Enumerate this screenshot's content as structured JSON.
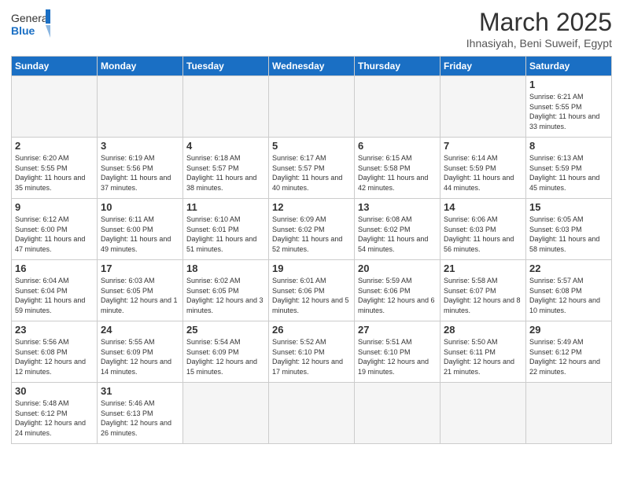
{
  "header": {
    "logo_general": "General",
    "logo_blue": "Blue",
    "month_title": "March 2025",
    "location": "Ihnasiyah, Beni Suweif, Egypt"
  },
  "weekdays": [
    "Sunday",
    "Monday",
    "Tuesday",
    "Wednesday",
    "Thursday",
    "Friday",
    "Saturday"
  ],
  "weeks": [
    [
      {
        "day": "",
        "info": ""
      },
      {
        "day": "",
        "info": ""
      },
      {
        "day": "",
        "info": ""
      },
      {
        "day": "",
        "info": ""
      },
      {
        "day": "",
        "info": ""
      },
      {
        "day": "",
        "info": ""
      },
      {
        "day": "1",
        "info": "Sunrise: 6:21 AM\nSunset: 5:55 PM\nDaylight: 11 hours\nand 33 minutes."
      }
    ],
    [
      {
        "day": "2",
        "info": "Sunrise: 6:20 AM\nSunset: 5:55 PM\nDaylight: 11 hours\nand 35 minutes."
      },
      {
        "day": "3",
        "info": "Sunrise: 6:19 AM\nSunset: 5:56 PM\nDaylight: 11 hours\nand 37 minutes."
      },
      {
        "day": "4",
        "info": "Sunrise: 6:18 AM\nSunset: 5:57 PM\nDaylight: 11 hours\nand 38 minutes."
      },
      {
        "day": "5",
        "info": "Sunrise: 6:17 AM\nSunset: 5:57 PM\nDaylight: 11 hours\nand 40 minutes."
      },
      {
        "day": "6",
        "info": "Sunrise: 6:15 AM\nSunset: 5:58 PM\nDaylight: 11 hours\nand 42 minutes."
      },
      {
        "day": "7",
        "info": "Sunrise: 6:14 AM\nSunset: 5:59 PM\nDaylight: 11 hours\nand 44 minutes."
      },
      {
        "day": "8",
        "info": "Sunrise: 6:13 AM\nSunset: 5:59 PM\nDaylight: 11 hours\nand 45 minutes."
      }
    ],
    [
      {
        "day": "9",
        "info": "Sunrise: 6:12 AM\nSunset: 6:00 PM\nDaylight: 11 hours\nand 47 minutes."
      },
      {
        "day": "10",
        "info": "Sunrise: 6:11 AM\nSunset: 6:00 PM\nDaylight: 11 hours\nand 49 minutes."
      },
      {
        "day": "11",
        "info": "Sunrise: 6:10 AM\nSunset: 6:01 PM\nDaylight: 11 hours\nand 51 minutes."
      },
      {
        "day": "12",
        "info": "Sunrise: 6:09 AM\nSunset: 6:02 PM\nDaylight: 11 hours\nand 52 minutes."
      },
      {
        "day": "13",
        "info": "Sunrise: 6:08 AM\nSunset: 6:02 PM\nDaylight: 11 hours\nand 54 minutes."
      },
      {
        "day": "14",
        "info": "Sunrise: 6:06 AM\nSunset: 6:03 PM\nDaylight: 11 hours\nand 56 minutes."
      },
      {
        "day": "15",
        "info": "Sunrise: 6:05 AM\nSunset: 6:03 PM\nDaylight: 11 hours\nand 58 minutes."
      }
    ],
    [
      {
        "day": "16",
        "info": "Sunrise: 6:04 AM\nSunset: 6:04 PM\nDaylight: 11 hours\nand 59 minutes."
      },
      {
        "day": "17",
        "info": "Sunrise: 6:03 AM\nSunset: 6:05 PM\nDaylight: 12 hours\nand 1 minute."
      },
      {
        "day": "18",
        "info": "Sunrise: 6:02 AM\nSunset: 6:05 PM\nDaylight: 12 hours\nand 3 minutes."
      },
      {
        "day": "19",
        "info": "Sunrise: 6:01 AM\nSunset: 6:06 PM\nDaylight: 12 hours\nand 5 minutes."
      },
      {
        "day": "20",
        "info": "Sunrise: 5:59 AM\nSunset: 6:06 PM\nDaylight: 12 hours\nand 6 minutes."
      },
      {
        "day": "21",
        "info": "Sunrise: 5:58 AM\nSunset: 6:07 PM\nDaylight: 12 hours\nand 8 minutes."
      },
      {
        "day": "22",
        "info": "Sunrise: 5:57 AM\nSunset: 6:08 PM\nDaylight: 12 hours\nand 10 minutes."
      }
    ],
    [
      {
        "day": "23",
        "info": "Sunrise: 5:56 AM\nSunset: 6:08 PM\nDaylight: 12 hours\nand 12 minutes."
      },
      {
        "day": "24",
        "info": "Sunrise: 5:55 AM\nSunset: 6:09 PM\nDaylight: 12 hours\nand 14 minutes."
      },
      {
        "day": "25",
        "info": "Sunrise: 5:54 AM\nSunset: 6:09 PM\nDaylight: 12 hours\nand 15 minutes."
      },
      {
        "day": "26",
        "info": "Sunrise: 5:52 AM\nSunset: 6:10 PM\nDaylight: 12 hours\nand 17 minutes."
      },
      {
        "day": "27",
        "info": "Sunrise: 5:51 AM\nSunset: 6:10 PM\nDaylight: 12 hours\nand 19 minutes."
      },
      {
        "day": "28",
        "info": "Sunrise: 5:50 AM\nSunset: 6:11 PM\nDaylight: 12 hours\nand 21 minutes."
      },
      {
        "day": "29",
        "info": "Sunrise: 5:49 AM\nSunset: 6:12 PM\nDaylight: 12 hours\nand 22 minutes."
      }
    ],
    [
      {
        "day": "30",
        "info": "Sunrise: 5:48 AM\nSunset: 6:12 PM\nDaylight: 12 hours\nand 24 minutes."
      },
      {
        "day": "31",
        "info": "Sunrise: 5:46 AM\nSunset: 6:13 PM\nDaylight: 12 hours\nand 26 minutes."
      },
      {
        "day": "",
        "info": ""
      },
      {
        "day": "",
        "info": ""
      },
      {
        "day": "",
        "info": ""
      },
      {
        "day": "",
        "info": ""
      },
      {
        "day": "",
        "info": ""
      }
    ]
  ]
}
